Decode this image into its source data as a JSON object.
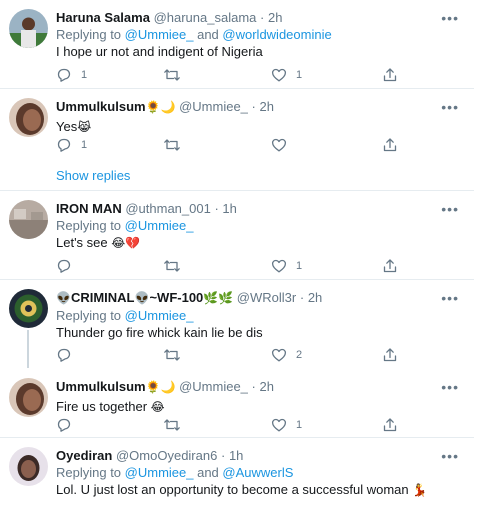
{
  "colors": {
    "link": "#1b95e0",
    "muted": "#657786",
    "text": "#14171a",
    "divider": "#e6ecf0"
  },
  "tweets": [
    {
      "name": "Haruna Salama",
      "handle": "@haruna_salama",
      "time": "2h",
      "replying_prefix": "Replying to ",
      "replying_to": [
        "@Ummiee_",
        "@worldwideominie"
      ],
      "replying_and": " and ",
      "text": "I hope ur not and indigent of Nigeria",
      "counts": {
        "reply": "1",
        "retweet": "",
        "like": "1"
      }
    },
    {
      "name": "Ummulkulsum",
      "name_emoji": "🌻🌙",
      "handle": "@Ummiee_",
      "time": "2h",
      "text": "Yes",
      "text_emoji": "😹",
      "counts": {
        "reply": "1",
        "retweet": "",
        "like": ""
      },
      "show_replies": "Show replies"
    },
    {
      "name": "IRON MAN",
      "handle": "@uthman_001",
      "time": "1h",
      "replying_prefix": "Replying to ",
      "replying_to": [
        "@Ummiee_"
      ],
      "text": "Let's see",
      "text_emoji": "😂💔",
      "counts": {
        "reply": "",
        "retweet": "",
        "like": "1"
      }
    },
    {
      "name": "CRIMINAL",
      "name_prefix_emoji": "👽",
      "name_suffix": "~WF-100",
      "name_emoji": "👽",
      "name_suffix_emoji": "🌿🌿",
      "handle": "@WRoll3r",
      "time": "2h",
      "replying_prefix": "Replying to ",
      "replying_to": [
        "@Ummiee_"
      ],
      "text": "Thunder go fire whick kain lie be dis",
      "counts": {
        "reply": "",
        "retweet": "",
        "like": "2"
      }
    },
    {
      "name": "Ummulkulsum",
      "name_emoji": "🌻🌙",
      "handle": "@Ummiee_",
      "time": "2h",
      "text": "Fire us together",
      "text_emoji": "😂",
      "counts": {
        "reply": "",
        "retweet": "",
        "like": "1"
      }
    },
    {
      "name": "Oyediran",
      "handle": "@OmoOyediran6",
      "time": "1h",
      "replying_prefix": "Replying to ",
      "replying_to": [
        "@Ummiee_",
        "@AuwwerlS"
      ],
      "replying_and": " and ",
      "text": "Lol. U just lost an opportunity to become a successful woman",
      "text_emoji": "💃"
    }
  ],
  "separator_dot": "·",
  "icons": {
    "reply": "reply-icon",
    "retweet": "retweet-icon",
    "like": "heart-icon",
    "share": "share-icon",
    "more": "more-icon"
  }
}
